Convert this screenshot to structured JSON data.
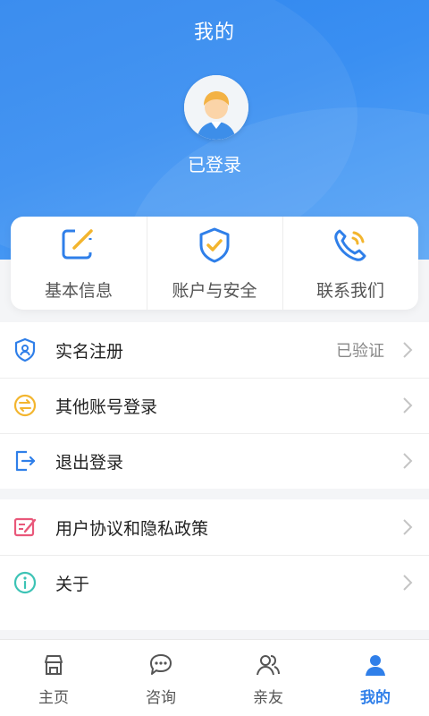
{
  "header": {
    "title": "我的",
    "login_state": "已登录"
  },
  "quick_actions": [
    {
      "label": "基本信息",
      "icon": "edit-icon"
    },
    {
      "label": "账户与安全",
      "icon": "shield-check-icon"
    },
    {
      "label": "联系我们",
      "icon": "phone-icon"
    }
  ],
  "menu_group1": [
    {
      "label": "实名注册",
      "value": "已验证",
      "icon": "id-shield-icon"
    },
    {
      "label": "其他账号登录",
      "value": "",
      "icon": "switch-account-icon"
    },
    {
      "label": "退出登录",
      "value": "",
      "icon": "logout-icon"
    }
  ],
  "menu_group2": [
    {
      "label": "用户协议和隐私政策",
      "value": "",
      "icon": "agreement-icon"
    },
    {
      "label": "关于",
      "value": "",
      "icon": "info-icon"
    }
  ],
  "tabbar": {
    "items": [
      {
        "label": "主页",
        "icon": "home-icon",
        "active": false
      },
      {
        "label": "咨询",
        "icon": "chat-icon",
        "active": false
      },
      {
        "label": "亲友",
        "icon": "friends-icon",
        "active": false
      },
      {
        "label": "我的",
        "icon": "profile-icon",
        "active": true
      }
    ]
  },
  "colors": {
    "accent": "#2f7fe9",
    "header_bg": "#3a8ff2",
    "icon_yellow": "#f3b52e",
    "icon_red": "#e9587a",
    "icon_teal": "#3cc3b5"
  }
}
